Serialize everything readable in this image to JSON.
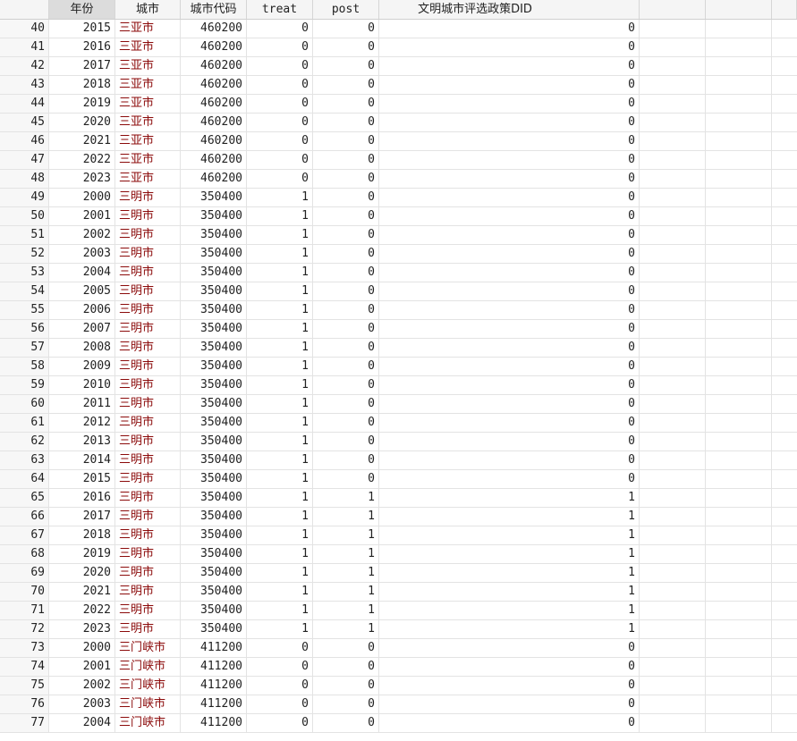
{
  "columns": [
    "",
    "年份",
    "城市",
    "城市代码",
    "treat",
    "post",
    "文明城市评选政策DID",
    "",
    "",
    ""
  ],
  "rows": [
    {
      "obs": "40",
      "year": "2015",
      "city": "三亚市",
      "code": "460200",
      "treat": "0",
      "post": "0",
      "did": "0"
    },
    {
      "obs": "41",
      "year": "2016",
      "city": "三亚市",
      "code": "460200",
      "treat": "0",
      "post": "0",
      "did": "0"
    },
    {
      "obs": "42",
      "year": "2017",
      "city": "三亚市",
      "code": "460200",
      "treat": "0",
      "post": "0",
      "did": "0"
    },
    {
      "obs": "43",
      "year": "2018",
      "city": "三亚市",
      "code": "460200",
      "treat": "0",
      "post": "0",
      "did": "0"
    },
    {
      "obs": "44",
      "year": "2019",
      "city": "三亚市",
      "code": "460200",
      "treat": "0",
      "post": "0",
      "did": "0"
    },
    {
      "obs": "45",
      "year": "2020",
      "city": "三亚市",
      "code": "460200",
      "treat": "0",
      "post": "0",
      "did": "0"
    },
    {
      "obs": "46",
      "year": "2021",
      "city": "三亚市",
      "code": "460200",
      "treat": "0",
      "post": "0",
      "did": "0"
    },
    {
      "obs": "47",
      "year": "2022",
      "city": "三亚市",
      "code": "460200",
      "treat": "0",
      "post": "0",
      "did": "0"
    },
    {
      "obs": "48",
      "year": "2023",
      "city": "三亚市",
      "code": "460200",
      "treat": "0",
      "post": "0",
      "did": "0"
    },
    {
      "obs": "49",
      "year": "2000",
      "city": "三明市",
      "code": "350400",
      "treat": "1",
      "post": "0",
      "did": "0"
    },
    {
      "obs": "50",
      "year": "2001",
      "city": "三明市",
      "code": "350400",
      "treat": "1",
      "post": "0",
      "did": "0"
    },
    {
      "obs": "51",
      "year": "2002",
      "city": "三明市",
      "code": "350400",
      "treat": "1",
      "post": "0",
      "did": "0"
    },
    {
      "obs": "52",
      "year": "2003",
      "city": "三明市",
      "code": "350400",
      "treat": "1",
      "post": "0",
      "did": "0"
    },
    {
      "obs": "53",
      "year": "2004",
      "city": "三明市",
      "code": "350400",
      "treat": "1",
      "post": "0",
      "did": "0"
    },
    {
      "obs": "54",
      "year": "2005",
      "city": "三明市",
      "code": "350400",
      "treat": "1",
      "post": "0",
      "did": "0"
    },
    {
      "obs": "55",
      "year": "2006",
      "city": "三明市",
      "code": "350400",
      "treat": "1",
      "post": "0",
      "did": "0"
    },
    {
      "obs": "56",
      "year": "2007",
      "city": "三明市",
      "code": "350400",
      "treat": "1",
      "post": "0",
      "did": "0"
    },
    {
      "obs": "57",
      "year": "2008",
      "city": "三明市",
      "code": "350400",
      "treat": "1",
      "post": "0",
      "did": "0"
    },
    {
      "obs": "58",
      "year": "2009",
      "city": "三明市",
      "code": "350400",
      "treat": "1",
      "post": "0",
      "did": "0"
    },
    {
      "obs": "59",
      "year": "2010",
      "city": "三明市",
      "code": "350400",
      "treat": "1",
      "post": "0",
      "did": "0"
    },
    {
      "obs": "60",
      "year": "2011",
      "city": "三明市",
      "code": "350400",
      "treat": "1",
      "post": "0",
      "did": "0"
    },
    {
      "obs": "61",
      "year": "2012",
      "city": "三明市",
      "code": "350400",
      "treat": "1",
      "post": "0",
      "did": "0"
    },
    {
      "obs": "62",
      "year": "2013",
      "city": "三明市",
      "code": "350400",
      "treat": "1",
      "post": "0",
      "did": "0"
    },
    {
      "obs": "63",
      "year": "2014",
      "city": "三明市",
      "code": "350400",
      "treat": "1",
      "post": "0",
      "did": "0"
    },
    {
      "obs": "64",
      "year": "2015",
      "city": "三明市",
      "code": "350400",
      "treat": "1",
      "post": "0",
      "did": "0"
    },
    {
      "obs": "65",
      "year": "2016",
      "city": "三明市",
      "code": "350400",
      "treat": "1",
      "post": "1",
      "did": "1"
    },
    {
      "obs": "66",
      "year": "2017",
      "city": "三明市",
      "code": "350400",
      "treat": "1",
      "post": "1",
      "did": "1"
    },
    {
      "obs": "67",
      "year": "2018",
      "city": "三明市",
      "code": "350400",
      "treat": "1",
      "post": "1",
      "did": "1"
    },
    {
      "obs": "68",
      "year": "2019",
      "city": "三明市",
      "code": "350400",
      "treat": "1",
      "post": "1",
      "did": "1"
    },
    {
      "obs": "69",
      "year": "2020",
      "city": "三明市",
      "code": "350400",
      "treat": "1",
      "post": "1",
      "did": "1"
    },
    {
      "obs": "70",
      "year": "2021",
      "city": "三明市",
      "code": "350400",
      "treat": "1",
      "post": "1",
      "did": "1"
    },
    {
      "obs": "71",
      "year": "2022",
      "city": "三明市",
      "code": "350400",
      "treat": "1",
      "post": "1",
      "did": "1"
    },
    {
      "obs": "72",
      "year": "2023",
      "city": "三明市",
      "code": "350400",
      "treat": "1",
      "post": "1",
      "did": "1"
    },
    {
      "obs": "73",
      "year": "2000",
      "city": "三门峡市",
      "code": "411200",
      "treat": "0",
      "post": "0",
      "did": "0"
    },
    {
      "obs": "74",
      "year": "2001",
      "city": "三门峡市",
      "code": "411200",
      "treat": "0",
      "post": "0",
      "did": "0"
    },
    {
      "obs": "75",
      "year": "2002",
      "city": "三门峡市",
      "code": "411200",
      "treat": "0",
      "post": "0",
      "did": "0"
    },
    {
      "obs": "76",
      "year": "2003",
      "city": "三门峡市",
      "code": "411200",
      "treat": "0",
      "post": "0",
      "did": "0"
    },
    {
      "obs": "77",
      "year": "2004",
      "city": "三门峡市",
      "code": "411200",
      "treat": "0",
      "post": "0",
      "did": "0"
    }
  ]
}
